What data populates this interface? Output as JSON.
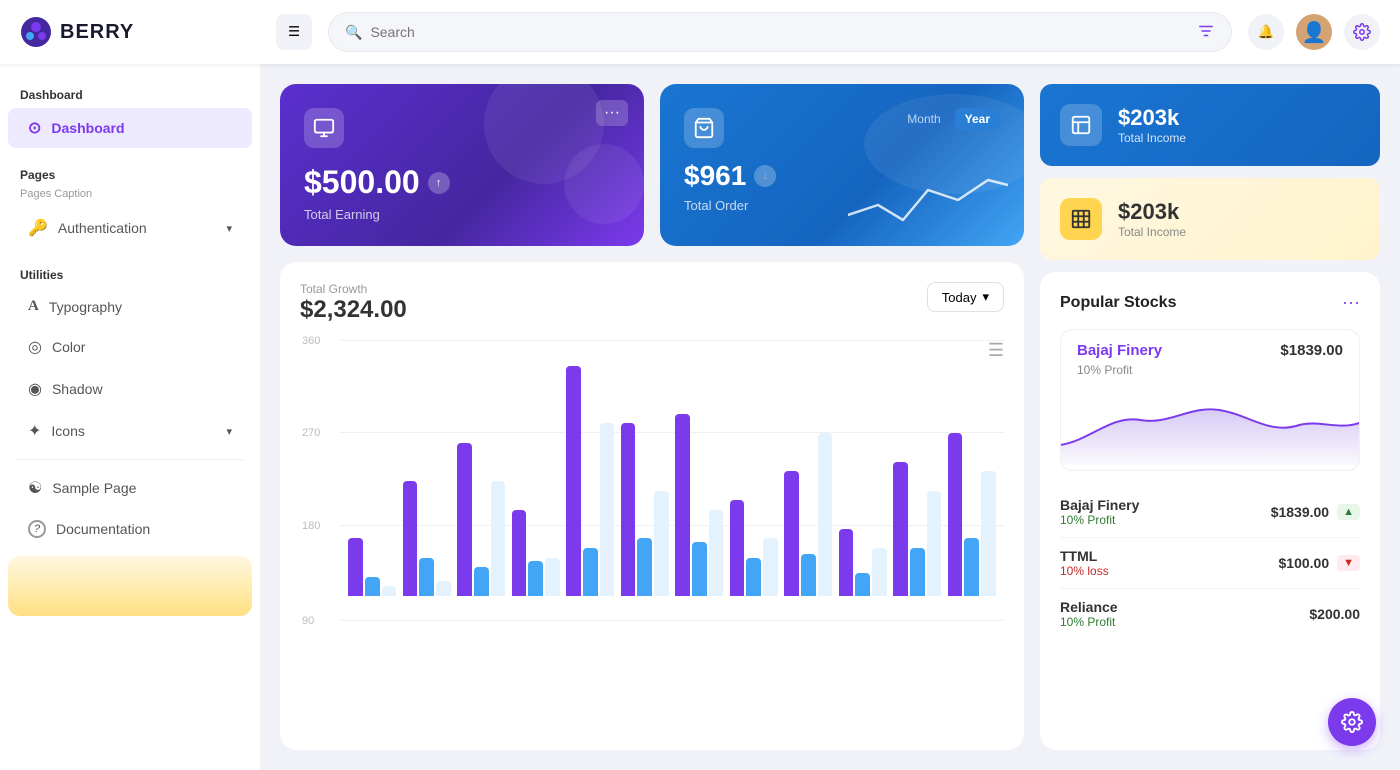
{
  "app": {
    "name": "BERRY"
  },
  "header": {
    "search_placeholder": "Search",
    "menu_icon": "☰",
    "notif_icon": "🔔",
    "settings_icon": "⚙",
    "avatar_emoji": "👤",
    "filter_icon": "⚙"
  },
  "sidebar": {
    "dashboard_section": "Dashboard",
    "pages_section": "Pages",
    "pages_caption": "Pages Caption",
    "utilities_section": "Utilities",
    "items": [
      {
        "id": "dashboard",
        "label": "Dashboard",
        "icon": "⊙",
        "active": true
      },
      {
        "id": "authentication",
        "label": "Authentication",
        "icon": "🔑",
        "hasChevron": true
      },
      {
        "id": "typography",
        "label": "Typography",
        "icon": "A"
      },
      {
        "id": "color",
        "label": "Color",
        "icon": "◎"
      },
      {
        "id": "shadow",
        "label": "Shadow",
        "icon": "◉"
      },
      {
        "id": "icons",
        "label": "Icons",
        "icon": "✦",
        "hasChevron": true
      },
      {
        "id": "sample-page",
        "label": "Sample Page",
        "icon": "☯"
      },
      {
        "id": "documentation",
        "label": "Documentation",
        "icon": "?"
      }
    ]
  },
  "cards": {
    "earning": {
      "amount": "$500.00",
      "label": "Total Earning",
      "more": "···"
    },
    "order": {
      "amount": "$961",
      "label": "Total Order",
      "tab_month": "Month",
      "tab_year": "Year"
    },
    "income_blue": {
      "amount": "$203k",
      "label": "Total Income"
    },
    "income_yellow": {
      "amount": "$203k",
      "label": "Total Income"
    }
  },
  "growth_chart": {
    "title": "Total Growth",
    "amount": "$2,324.00",
    "button_label": "Today",
    "y_labels": [
      "360",
      "270",
      "180",
      "90"
    ],
    "bars": [
      {
        "purple": 30,
        "blue": 10,
        "light": 5
      },
      {
        "purple": 60,
        "blue": 20,
        "light": 8
      },
      {
        "purple": 80,
        "blue": 15,
        "light": 60
      },
      {
        "purple": 45,
        "blue": 18,
        "light": 20
      },
      {
        "purple": 120,
        "blue": 25,
        "light": 90
      },
      {
        "purple": 90,
        "blue": 30,
        "light": 55
      },
      {
        "purple": 95,
        "blue": 28,
        "light": 45
      },
      {
        "purple": 50,
        "blue": 20,
        "light": 30
      },
      {
        "purple": 65,
        "blue": 22,
        "light": 85
      },
      {
        "purple": 35,
        "blue": 12,
        "light": 25
      },
      {
        "purple": 70,
        "blue": 25,
        "light": 55
      },
      {
        "purple": 85,
        "blue": 30,
        "light": 65
      }
    ]
  },
  "popular_stocks": {
    "title": "Popular Stocks",
    "featured": {
      "name": "Bajaj Finery",
      "price": "$1839.00",
      "profit": "10% Profit"
    },
    "rows": [
      {
        "name": "Bajaj Finery",
        "price": "$1839.00",
        "profit": "10% Profit",
        "trend": "up"
      },
      {
        "name": "TTML",
        "price": "$100.00",
        "profit": "10% loss",
        "trend": "down"
      },
      {
        "name": "Reliance",
        "price": "$200.00",
        "profit": "10% Profit",
        "trend": "up"
      }
    ]
  },
  "fab": {
    "icon": "⚙"
  }
}
